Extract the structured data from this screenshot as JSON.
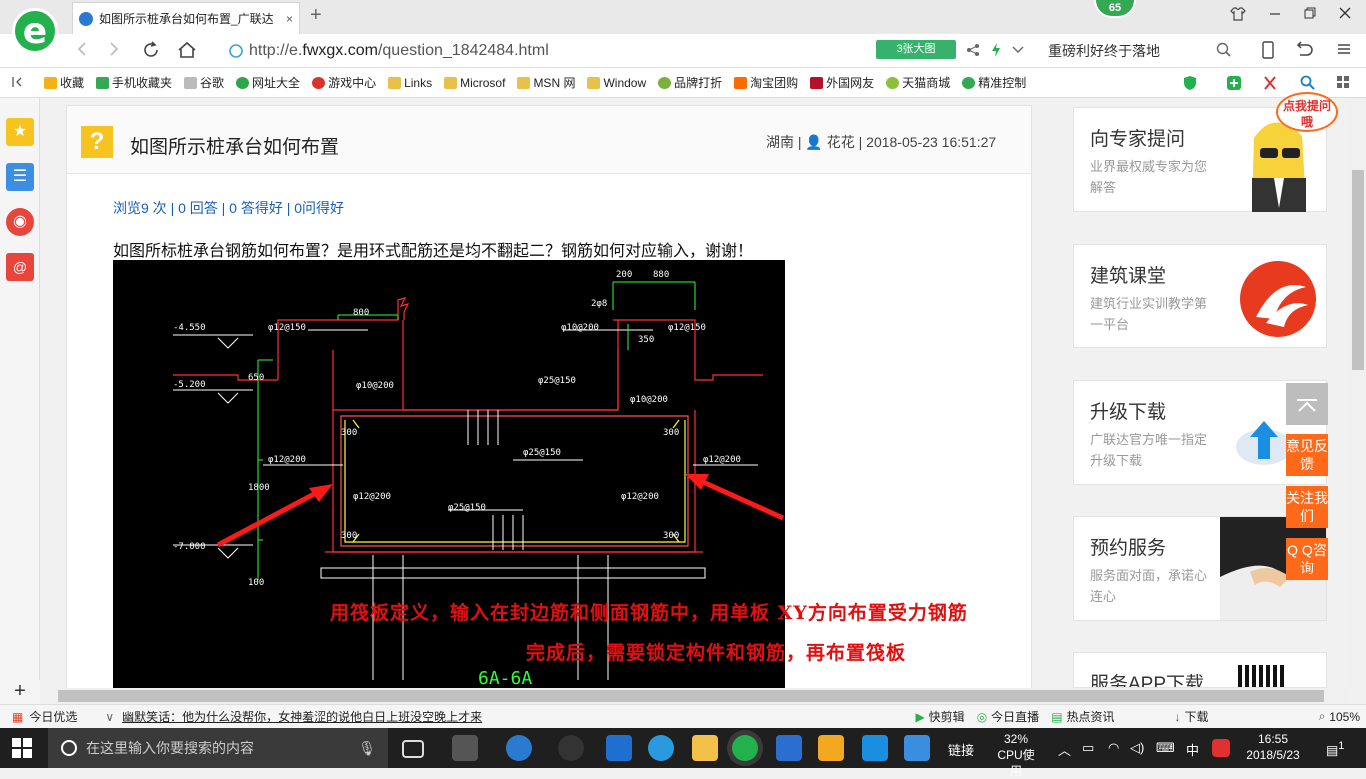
{
  "browser": {
    "tab_title": "如图所示桩承台如何布置_广联达",
    "tab_close": "×",
    "new_tab": "+",
    "badge": "65",
    "url_prefix": "http://e.",
    "url_domain": "fwxgx.com",
    "url_path": "/question_1842484.html",
    "big_pic_label": "3张大图",
    "news_text": "重磅利好终于落地",
    "logo_letter": "e"
  },
  "bookmarks": [
    {
      "label": "收藏",
      "color": "#f3b316"
    },
    {
      "label": "手机收藏夹",
      "color": "#35a853"
    },
    {
      "label": "谷歌",
      "color": "#bbbbbb"
    },
    {
      "label": "网址大全",
      "color": "#2fa54a"
    },
    {
      "label": "游戏中心",
      "color": "#d8342c"
    },
    {
      "label": "Links",
      "color": "#e8c04a"
    },
    {
      "label": "Microsof",
      "color": "#e8c04a"
    },
    {
      "label": "MSN 网",
      "color": "#e8c04a"
    },
    {
      "label": "Window",
      "color": "#e8c04a"
    },
    {
      "label": "品牌打折",
      "color": "#7bb03a"
    },
    {
      "label": "淘宝团购",
      "color": "#ff6a00"
    },
    {
      "label": "外国网友",
      "color": "#b3122a"
    },
    {
      "label": "天猫商城",
      "color": "#8cbf3a"
    },
    {
      "label": "精准控制",
      "color": "#33a853"
    }
  ],
  "question": {
    "icon": "?",
    "title": "如图所示桩承台如何布置",
    "meta": "湖南 | 👤 花花 | 2018-05-23 16:51:27",
    "stats": "浏览9 次 | 0 回答 | 0 答得好 | 0问得好",
    "body": "如图所标桩承台钢筋如何布置？是用环式配筋还是均不翻起二？钢筋如何对应输入，谢谢！",
    "overlay_line1": "用筏板定义，输入在封边筋和侧面钢筋中，用单板 XY方向布置受力钢筋",
    "overlay_line2": "完成后，需要锁定构件和钢筋，再布置筏板"
  },
  "cad_labels": {
    "section": "6A-6A",
    "levels": [
      "-4.550",
      "-5.200",
      "-7.000"
    ],
    "rebars": [
      "φ12@150",
      "φ12@150",
      "φ10@200",
      "φ10@200",
      "φ10@200",
      "φ25@150",
      "φ25@150",
      "φ25@150",
      "φ12@200",
      "φ12@200",
      "φ12@200",
      "φ12@200"
    ],
    "dims": [
      "800",
      "200",
      "880",
      "2φ8",
      "650",
      "1800",
      "350",
      "100",
      "300",
      "300",
      "300",
      "300"
    ]
  },
  "sidebar": [
    {
      "title": "向专家提问",
      "sub": "业界最权威专家为您解答",
      "promo": "点我提问哦"
    },
    {
      "title": "建筑课堂",
      "sub": "建筑行业实训教学第一平台"
    },
    {
      "title": "升级下载",
      "sub": "广联达官方唯一指定升级下载"
    },
    {
      "title": "预约服务",
      "sub": "服务面对面，承诺心连心"
    },
    {
      "title": "服务APP下载",
      "sub": ""
    }
  ],
  "float_buttons": [
    "意见反馈",
    "关注我们",
    "Q Q咨询"
  ],
  "statusbar": {
    "left": "今日优选",
    "ticker": "幽默笑话：他为什么没帮你，女神羞涩的说他白日上班没空晚上才来",
    "items": [
      "快剪辑",
      "今日直播",
      "热点资讯",
      "下载"
    ],
    "zoom": "105%"
  },
  "taskbar": {
    "search_placeholder": "在这里输入你要搜索的内容",
    "link": "链接",
    "cpu_pct": "32%",
    "cpu_label": "CPU使用",
    "ime": "中",
    "time": "16:55",
    "date": "2018/5/23",
    "notif": "1"
  },
  "colors": {
    "accent": "#22b14c",
    "link": "#1a5fb4",
    "orange": "#ff6a1a",
    "red": "#e01010"
  }
}
